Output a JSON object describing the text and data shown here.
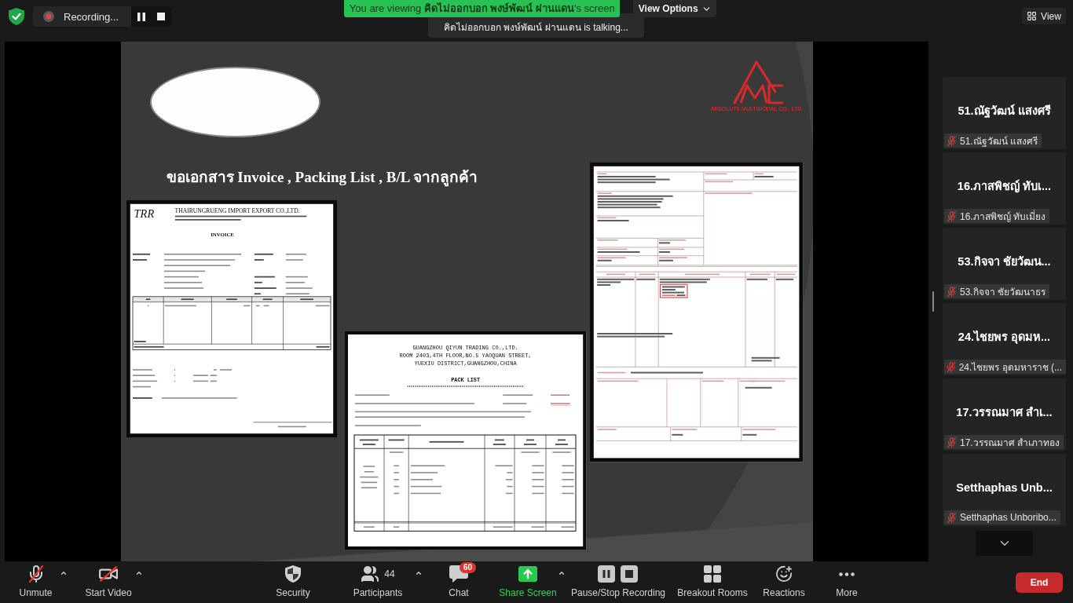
{
  "top_bar": {
    "recording_label": "Recording...",
    "share_banner": "You are viewing **คิดไม่ออกบอก พงษ์พัฒน์ ผ่านแดน**'s screen",
    "view_options": "View Options",
    "talking": "คิดไม่ออกบอก พงษ์พัฒน์ ผ่านแดน is talking...",
    "view_button": "View"
  },
  "slide": {
    "logo_caption": "ABSOLUTE MULTIMODAL CO., LTD.",
    "title": "ขอเอกสาร Invoice , Packing List , B/L จากลูกค้า",
    "invoice": {
      "logo": "TRR",
      "company": "THAIRUNGRUENG IMPORT EXPORT CO.,LTD.",
      "title": "INVOICE"
    },
    "pack_list": {
      "company_lines": [
        "GUANGZHOU QIYUN TRADING CO.,LTD.",
        "ROOM 2403,4TH FLOOR,NO.5 YAOQUAN STREET,",
        "YUEXIU DISTRICT,GUANGZHOU,CHINA"
      ],
      "title": "PACK LIST"
    }
  },
  "participants": [
    {
      "tile_name": "51.ณัฐวัฒน์ แสงศรี",
      "label": "51.ณัฐวัฒน์ แสงศรี",
      "muted": true
    },
    {
      "tile_name": "16.ภาสพิชญ์ ทับเ...",
      "label": "16.ภาสพิชญ์ ทับเมี่ยง",
      "muted": true
    },
    {
      "tile_name": "53.กิจจา ชัยวัฒน...",
      "label": "53.กิจจา ชัยวัฒนาธร",
      "muted": true
    },
    {
      "tile_name": "24.ไชยพร อุดมห...",
      "label": "24.ไชยพร อุดมหาราช (...",
      "muted": true
    },
    {
      "tile_name": "17.วรรณมาศ สำเ...",
      "label": "17.วรรณมาศ สำเภาทอง",
      "muted": true
    },
    {
      "tile_name": "Setthaphas Unb...",
      "label": "Setthaphas Unboribo...",
      "muted": true
    }
  ],
  "toolbar": {
    "items": [
      {
        "kind": "mic",
        "label": "Unmute",
        "off": true,
        "caret": true
      },
      {
        "kind": "video",
        "label": "Start Video",
        "off": true,
        "caret": true
      },
      {
        "kind": "security",
        "label": "Security",
        "caret": false
      },
      {
        "kind": "participants",
        "label": "Participants",
        "count": "44",
        "caret": true
      },
      {
        "kind": "chat",
        "label": "Chat",
        "badge": "60",
        "caret": false
      },
      {
        "kind": "share",
        "label": "Share Screen",
        "caret": true
      },
      {
        "kind": "recording",
        "label": "Pause/Stop Recording",
        "caret": false
      },
      {
        "kind": "breakout",
        "label": "Breakout Rooms",
        "caret": false
      },
      {
        "kind": "reactions",
        "label": "Reactions",
        "caret": false
      },
      {
        "kind": "more",
        "label": "More",
        "caret": false
      }
    ],
    "end_label": "End"
  }
}
